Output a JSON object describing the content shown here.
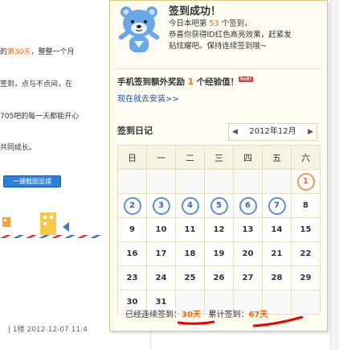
{
  "background": {
    "line1_pre": "的",
    "line1_highlight": "第30天",
    "line1_post": "，整整一个月",
    "line2": "签到，点与不点间，在",
    "line3": "705吧的每一天都能开心",
    "line4": "共同成长。",
    "button_label": "一键截图显摆",
    "footer": "| 1楼  2012-12-07 11:4"
  },
  "success": {
    "title": "签到成功！",
    "rank_pre": "今日本吧第 ",
    "rank_num": "53",
    "rank_post": " 个签到，",
    "congrats_line1": "恭喜你获得ID红色高亮效果，赶紧发",
    "congrats_line2": "贴炫耀吧。保持连续签到哦~"
  },
  "promo": {
    "text_pre": "手机签到额外奖励 ",
    "num": "1",
    "text_post": " 个经验值！",
    "badge": "hot!",
    "link": "现在就去安装>>"
  },
  "calendar": {
    "title": "签到日记",
    "month": "2012年12月",
    "prev": "◀",
    "next": "▶",
    "weekdays": [
      "日",
      "一",
      "二",
      "三",
      "四",
      "五",
      "六"
    ],
    "rows": [
      [
        "",
        "",
        "",
        "",
        "",
        "",
        "1"
      ],
      [
        "2",
        "3",
        "4",
        "5",
        "6",
        "7",
        "8"
      ],
      [
        "9",
        "10",
        "11",
        "12",
        "13",
        "14",
        "15"
      ],
      [
        "16",
        "17",
        "18",
        "19",
        "20",
        "21",
        "22"
      ],
      [
        "23",
        "24",
        "25",
        "26",
        "27",
        "28",
        "29"
      ],
      [
        "30",
        "31",
        "",
        "",
        "",
        "",
        ""
      ]
    ],
    "signed_days": [
      "1",
      "2",
      "3",
      "4",
      "5",
      "6",
      "7"
    ],
    "today": "1",
    "streak_label": "已经连续签到：",
    "streak_value": "30天",
    "total_label": "累计签到：",
    "total_value": "67天"
  },
  "colors": {
    "accent_orange": "#ff6600",
    "signed_circle": "#5b8fdb",
    "link_blue": "#1e50a2",
    "popup_bg": "#fffdf2"
  }
}
